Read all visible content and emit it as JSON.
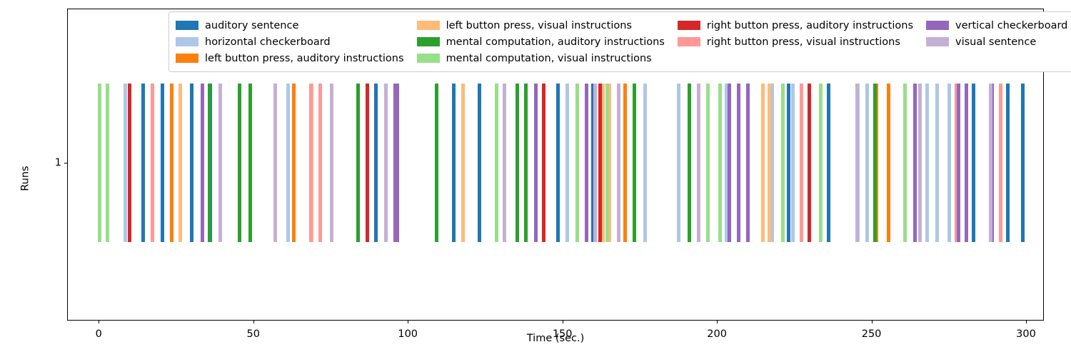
{
  "chart_data": {
    "type": "eventplot",
    "title": "",
    "xlabel": "Time (sec.)",
    "ylabel": "Runs",
    "xlim": [
      -10,
      306
    ],
    "xticks": [
      0,
      50,
      100,
      150,
      200,
      250,
      300
    ],
    "xticklabels": [
      "0",
      "50",
      "100",
      "150",
      "200",
      "250",
      "300"
    ],
    "yticks": [
      1
    ],
    "yticklabels": [
      "1"
    ],
    "grid": false,
    "legend_position": "upper center",
    "legend_ncol": 4,
    "colors": {
      "auditory sentence": "#1f77b4",
      "horizontal checkerboard": "#aec7e8",
      "left button press, auditory instructions": "#ff7f0e",
      "left button press, visual instructions": "#ffbb78",
      "mental computation, auditory instructions": "#2ca02c",
      "mental computation, visual instructions": "#98df8a",
      "right button press, auditory instructions": "#d62728",
      "right button press, visual instructions": "#ff9896",
      "vertical checkerboard": "#9467bd",
      "visual sentence": "#c5b0d5"
    },
    "series": [
      {
        "name": "auditory sentence",
        "color": "#1f77b4",
        "values": [
          14.4,
          20.7,
          30.1,
          36.0,
          89.6,
          114.8,
          123.1,
          148.5,
          151.6,
          159.8,
          223.1,
          236.2,
          283.1,
          294.1,
          299.0
        ]
      },
      {
        "name": "horizontal checkerboard",
        "color": "#aec7e8",
        "values": [
          8.5,
          61.2,
          151.5,
          176.7,
          187.5,
          203.0,
          217.8,
          224.5,
          245.7,
          248.5,
          268.1,
          271.2,
          275.2
        ]
      },
      {
        "name": "left button press, auditory instructions",
        "color": "#ff7f0e",
        "values": [
          23.5,
          63.1,
          170.4,
          251.6,
          255.6
        ]
      },
      {
        "name": "left button press, visual instructions",
        "color": "#ffbb78",
        "values": [
          26.4,
          68.9,
          117.9,
          163.1,
          165.2,
          214.8,
          216.9
        ]
      },
      {
        "name": "mental computation, auditory instructions",
        "color": "#2ca02c",
        "values": [
          35.8,
          45.6,
          49.0,
          83.8,
          109.4,
          135.4,
          138.2,
          173.4,
          191.0,
          251.1
        ]
      },
      {
        "name": "mental computation, visual instructions",
        "color": "#98df8a",
        "values": [
          0.2,
          2.8,
          128.7,
          154.8,
          164.6,
          197.2,
          201.0,
          221.4,
          233.6,
          260.9
        ]
      },
      {
        "name": "right button press, auditory instructions",
        "color": "#d62728",
        "values": [
          9.9,
          86.8,
          144.0,
          162.1,
          229.9
        ]
      },
      {
        "name": "right button press, visual instructions",
        "color": "#ff9896",
        "values": [
          17.4,
          68.7,
          71.6,
          227.3,
          277.4,
          291.8
        ]
      },
      {
        "name": "vertical checkerboard",
        "color": "#9467bd",
        "values": [
          33.6,
          95.8,
          96.5,
          141.4,
          157.9,
          204.1,
          207.1,
          210.0,
          264.1,
          278.2,
          280.6,
          289.1
        ]
      },
      {
        "name": "visual sentence",
        "color": "#c5b0d5",
        "values": [
          39.4,
          57.2,
          75.3,
          93.0,
          131.3,
          160.5,
          168.1,
          194.1,
          245.3,
          265.7,
          288.5
        ]
      }
    ]
  },
  "legend": {
    "columns": [
      [
        {
          "label": "auditory sentence",
          "color": "#1f77b4"
        },
        {
          "label": "horizontal checkerboard",
          "color": "#aec7e8"
        },
        {
          "label": "left button press, auditory instructions",
          "color": "#ff7f0e"
        }
      ],
      [
        {
          "label": "left button press, visual instructions",
          "color": "#ffbb78"
        },
        {
          "label": "mental computation, auditory instructions",
          "color": "#2ca02c"
        },
        {
          "label": "mental computation, visual instructions",
          "color": "#98df8a"
        }
      ],
      [
        {
          "label": "right button press, auditory instructions",
          "color": "#d62728"
        },
        {
          "label": "right button press, visual instructions",
          "color": "#ff9896"
        }
      ],
      [
        {
          "label": "vertical checkerboard",
          "color": "#9467bd"
        },
        {
          "label": "visual sentence",
          "color": "#c5b0d5"
        }
      ]
    ]
  }
}
